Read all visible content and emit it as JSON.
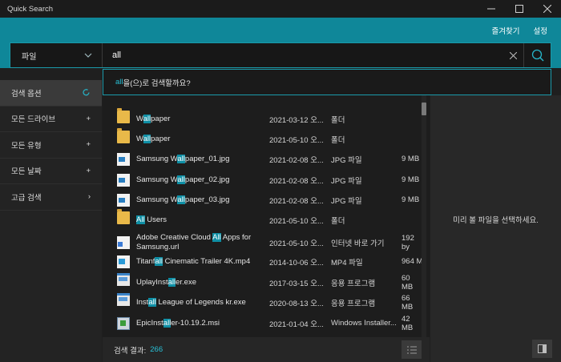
{
  "window": {
    "title": "Quick Search",
    "minimize": "–",
    "maximize": "☐",
    "close": "✕"
  },
  "header": {
    "favorites": "즐겨찾기",
    "settings": "설정"
  },
  "search": {
    "scope": "파일",
    "query": "all",
    "placeholder": ""
  },
  "suggestion": {
    "query_part": "all",
    "prefix_part": "을(으)로 검색할까요?"
  },
  "sidebar": {
    "items": [
      {
        "label": "검색 옵션",
        "icon": "refresh-icon",
        "active": true
      },
      {
        "label": "모든 드라이브",
        "icon": "plus-icon"
      },
      {
        "label": "모든 유형",
        "icon": "plus-icon"
      },
      {
        "label": "모든 날짜",
        "icon": "plus-icon"
      },
      {
        "label": "고급 검색",
        "icon": "chevron-right-icon"
      }
    ]
  },
  "results": [
    {
      "icon": "folder-icon",
      "pre": "W",
      "hl": "all",
      "post": "paper",
      "date": "2021-03-12 오...",
      "type": "폴더",
      "size": ""
    },
    {
      "icon": "folder-icon",
      "pre": "W",
      "hl": "all",
      "post": "paper",
      "date": "2021-05-10 오...",
      "type": "폴더",
      "size": ""
    },
    {
      "icon": "image-file-icon",
      "pre": "Samsung W",
      "hl": "all",
      "post": "paper_01.jpg",
      "date": "2021-02-08 오...",
      "type": "JPG 파일",
      "size": "9 MB"
    },
    {
      "icon": "image-file-icon",
      "pre": "Samsung W",
      "hl": "all",
      "post": "paper_02.jpg",
      "date": "2021-02-08 오...",
      "type": "JPG 파일",
      "size": "9 MB"
    },
    {
      "icon": "image-file-icon",
      "pre": "Samsung W",
      "hl": "all",
      "post": "paper_03.jpg",
      "date": "2021-02-08 오...",
      "type": "JPG 파일",
      "size": "9 MB"
    },
    {
      "icon": "folder-icon",
      "pre": "",
      "hl": "All",
      "post": " Users",
      "date": "2021-05-10 오...",
      "type": "폴더",
      "size": ""
    },
    {
      "icon": "url-file-icon",
      "pre": "Adobe Creative Cloud ",
      "hl": "All",
      "post": " Apps for Samsung.url",
      "date": "2021-05-10 오...",
      "type": "인터넷 바로 가기",
      "size": "192 by"
    },
    {
      "icon": "video-file-icon",
      "pre": "Titanf",
      "hl": "all",
      "post": "  Cinematic Trailer 4K.mp4",
      "date": "2014-10-06 오...",
      "type": "MP4 파일",
      "size": "964 M"
    },
    {
      "icon": "exe-file-icon",
      "pre": "UplayInst",
      "hl": "all",
      "post": "er.exe",
      "date": "2017-03-15 오...",
      "type": "응용 프로그램",
      "size": "60 MB"
    },
    {
      "icon": "exe-file-icon",
      "pre": "Inst",
      "hl": "all",
      "post": " League of Legends kr.exe",
      "date": "2020-08-13 오...",
      "type": "응용 프로그램",
      "size": "66 MB"
    },
    {
      "icon": "msi-file-icon",
      "pre": "EpicInst",
      "hl": "all",
      "post": "er-10.19.2.msi",
      "date": "2021-01-04 오...",
      "type": "Windows Installer...",
      "size": "42 MB"
    }
  ],
  "footer": {
    "label": "검색 결과:",
    "count": "266"
  },
  "preview": {
    "placeholder": "미리 볼 파일을 선택하세요."
  }
}
